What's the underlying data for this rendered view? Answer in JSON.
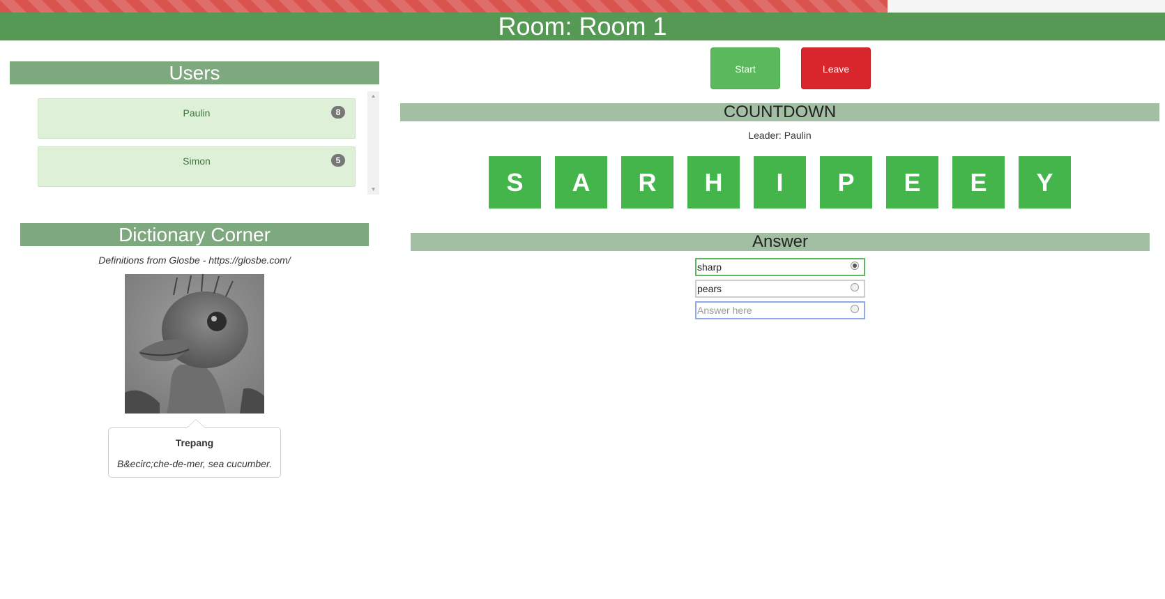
{
  "header": {
    "room_title": "Room: Room 1"
  },
  "timer": {
    "remaining_fraction": 0.762
  },
  "users": {
    "heading": "Users",
    "items": [
      {
        "name": "Paulin",
        "score": "8"
      },
      {
        "name": "Simon",
        "score": "5"
      }
    ]
  },
  "dictionary": {
    "heading": "Dictionary Corner",
    "source": "Definitions from Glosbe - https://glosbe.com/",
    "image_icon": "ostrich-photo",
    "word": "Trepang",
    "definition": "B&ecirc;che-de-mer, sea cucumber."
  },
  "controls": {
    "start_label": "Start",
    "leave_label": "Leave"
  },
  "game": {
    "mode": "COUNTDOWN",
    "leader": "Leader: Paulin",
    "letters": [
      "S",
      "A",
      "R",
      "H",
      "I",
      "P",
      "E",
      "E",
      "Y"
    ]
  },
  "answer": {
    "heading": "Answer",
    "entries": [
      {
        "text": "sharp",
        "selected": true
      },
      {
        "text": "pears",
        "selected": false
      }
    ],
    "input_value": "",
    "placeholder": "Answer here"
  },
  "colors": {
    "progress": "#d9534f",
    "header_green": "#559955",
    "tile_green": "#44b54a",
    "start_button": "#5cb85c",
    "leave_button": "#d9262c"
  }
}
